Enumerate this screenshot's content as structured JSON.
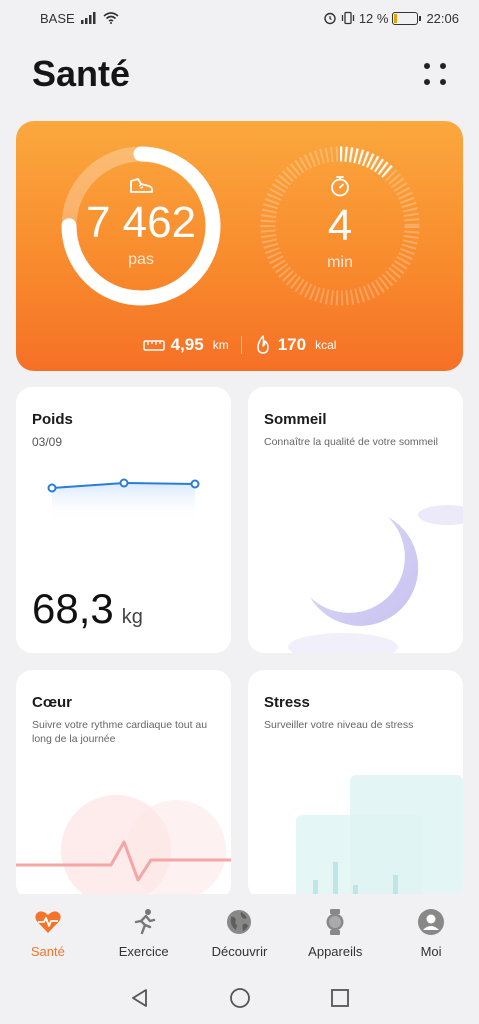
{
  "status_bar": {
    "carrier": "BASE",
    "battery": "12 %",
    "time": "22:06"
  },
  "header": {
    "title": "Santé"
  },
  "activity": {
    "steps_value": "7 462",
    "steps_unit": "pas",
    "steps_progress": 0.75,
    "time_value": "4",
    "time_unit": "min",
    "time_progress": 0.12,
    "distance_value": "4,95",
    "distance_unit": "km",
    "calories_value": "170",
    "calories_unit": "kcal",
    "colors": {
      "start": "#fba83e",
      "end": "#f57026"
    }
  },
  "cards": {
    "weight": {
      "title": "Poids",
      "date": "03/09",
      "value": "68,3",
      "unit": "kg"
    },
    "sleep": {
      "title": "Sommeil",
      "subtitle": "Connaître la qualité de votre sommeil"
    },
    "heart": {
      "title": "Cœur",
      "subtitle": "Suivre votre rythme cardiaque tout au long de la journée"
    },
    "stress": {
      "title": "Stress",
      "subtitle": "Surveiller votre niveau de stress"
    }
  },
  "bottom_nav": [
    {
      "label": "Santé",
      "icon": "heart-icon",
      "active": true
    },
    {
      "label": "Exercice",
      "icon": "running-icon",
      "active": false
    },
    {
      "label": "Découvrir",
      "icon": "globe-icon",
      "active": false
    },
    {
      "label": "Appareils",
      "icon": "watch-icon",
      "active": false
    },
    {
      "label": "Moi",
      "icon": "profile-icon",
      "active": false
    }
  ],
  "accent_color": "#f5742a"
}
